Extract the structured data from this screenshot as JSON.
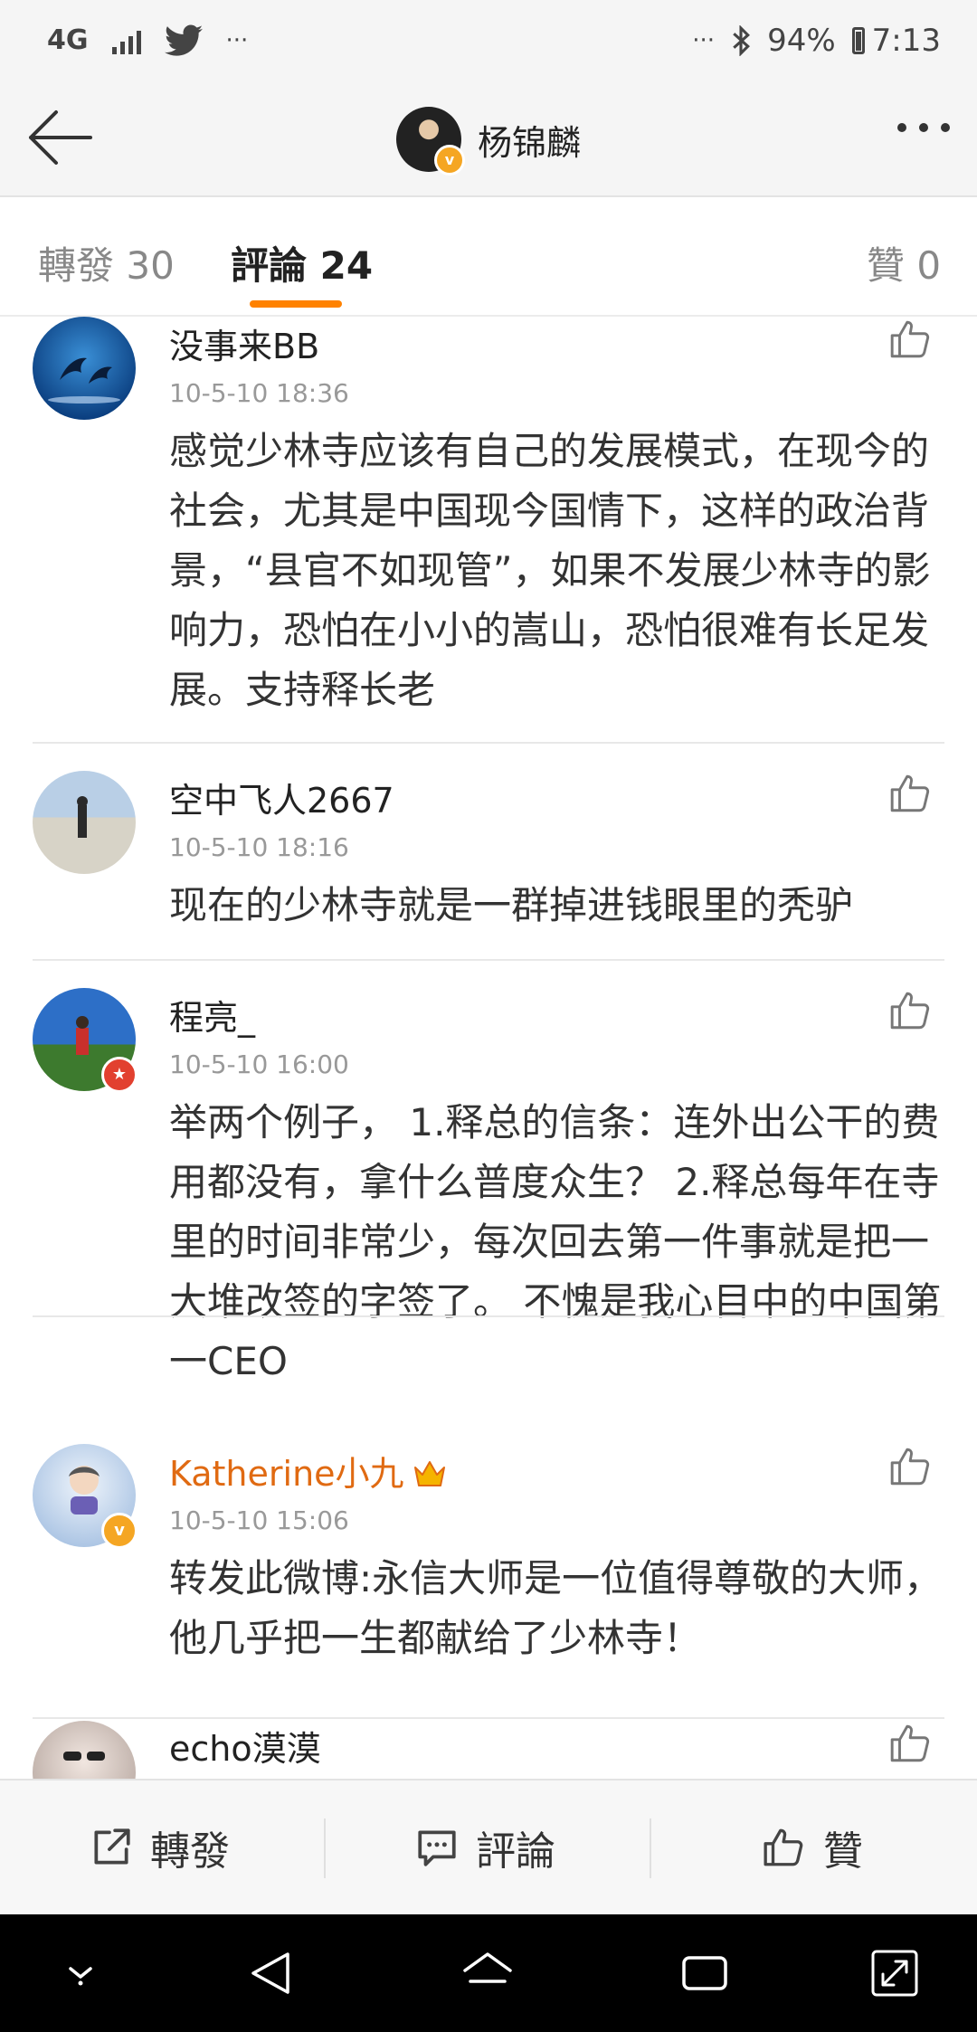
{
  "status_bar": {
    "network": "4G",
    "ellipsis_left": "···",
    "ellipsis_right": "···",
    "battery": "94%",
    "time": "7:13"
  },
  "header": {
    "title": "杨锦麟"
  },
  "tabs": [
    {
      "label": "轉發 30"
    },
    {
      "label": "評論 24"
    },
    {
      "label": "贊 0"
    }
  ],
  "comments": [
    {
      "name": "没事来BB",
      "time": "10-5-10 18:36",
      "text": "感觉少林寺应该有自己的发展模式，在现今的社会，尤其是中国现今国情下，这样的政治背景，“县官不如现管”，如果不发展少林寺的影响力，恐怕在小小的嵩山，恐怕很难有长足发展。支持释长老"
    },
    {
      "name": "空中飞人2667",
      "time": "10-5-10 18:16",
      "text": "现在的少林寺就是一群掉进钱眼里的秃驴"
    },
    {
      "name": "程亮_",
      "time": "10-5-10 16:00",
      "text": "举两个例子， 1.释总的信条：连外出公干的费用都没有，拿什么普度众生？ 2.释总每年在寺里的时间非常少，每次回去第一件事就是把一大堆改签的字签了。 不愧是我心目中的中国第一CEO"
    },
    {
      "name": "Katherine小九",
      "time": "10-5-10 15:06",
      "text": "转发此微博:永信大师是一位值得尊敬的大师，他几乎把一生都献给了少林寺！"
    },
    {
      "name": "echo漠漠",
      "time": "",
      "text": ""
    }
  ],
  "actions": {
    "repost": "轉發",
    "comment": "評論",
    "like": "贊"
  },
  "colors": {
    "accent": "#ff8200",
    "vip_name": "#e06a12",
    "verified": "#f5a623"
  }
}
